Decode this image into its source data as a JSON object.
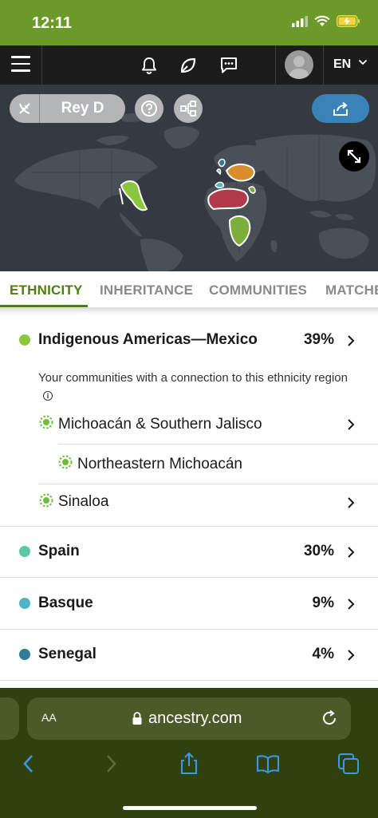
{
  "status_bar": {
    "time": "12:11"
  },
  "nav": {
    "language": "EN"
  },
  "map_header": {
    "tree_name": "Rey D"
  },
  "tabs": [
    {
      "label": "ETHNICITY",
      "active": true
    },
    {
      "label": "INHERITANCE",
      "active": false
    },
    {
      "label": "COMMUNITIES",
      "active": false
    },
    {
      "label": "MATCHES",
      "active": false
    }
  ],
  "regions": [
    {
      "name": "Indigenous Americas—Mexico",
      "percent": "39%",
      "color": "#8cc63f"
    },
    {
      "name": "Spain",
      "percent": "30%",
      "color": "#5cc9a0"
    },
    {
      "name": "Basque",
      "percent": "9%",
      "color": "#4fb3c9"
    },
    {
      "name": "Senegal",
      "percent": "4%",
      "color": "#2e7d94"
    }
  ],
  "communities": {
    "description": "Your communities with a connection to this ethnicity region",
    "info_glyph": "i",
    "items": [
      {
        "name": "Michoacán & Southern Jalisco",
        "level": 1
      },
      {
        "name": "Northeastern Michoacán",
        "level": 2
      },
      {
        "name": "Sinaloa",
        "level": 1
      }
    ]
  },
  "browser": {
    "text_size_label": "AA",
    "url": "ancestry.com"
  },
  "colors": {
    "status_bar": "#6b9a2b",
    "nav_bg": "#1c1c1c",
    "map_bg": "#353a40",
    "accent_green": "#4e7d14",
    "share_blue": "#3a83b8",
    "browser_bg": "#31400f"
  }
}
